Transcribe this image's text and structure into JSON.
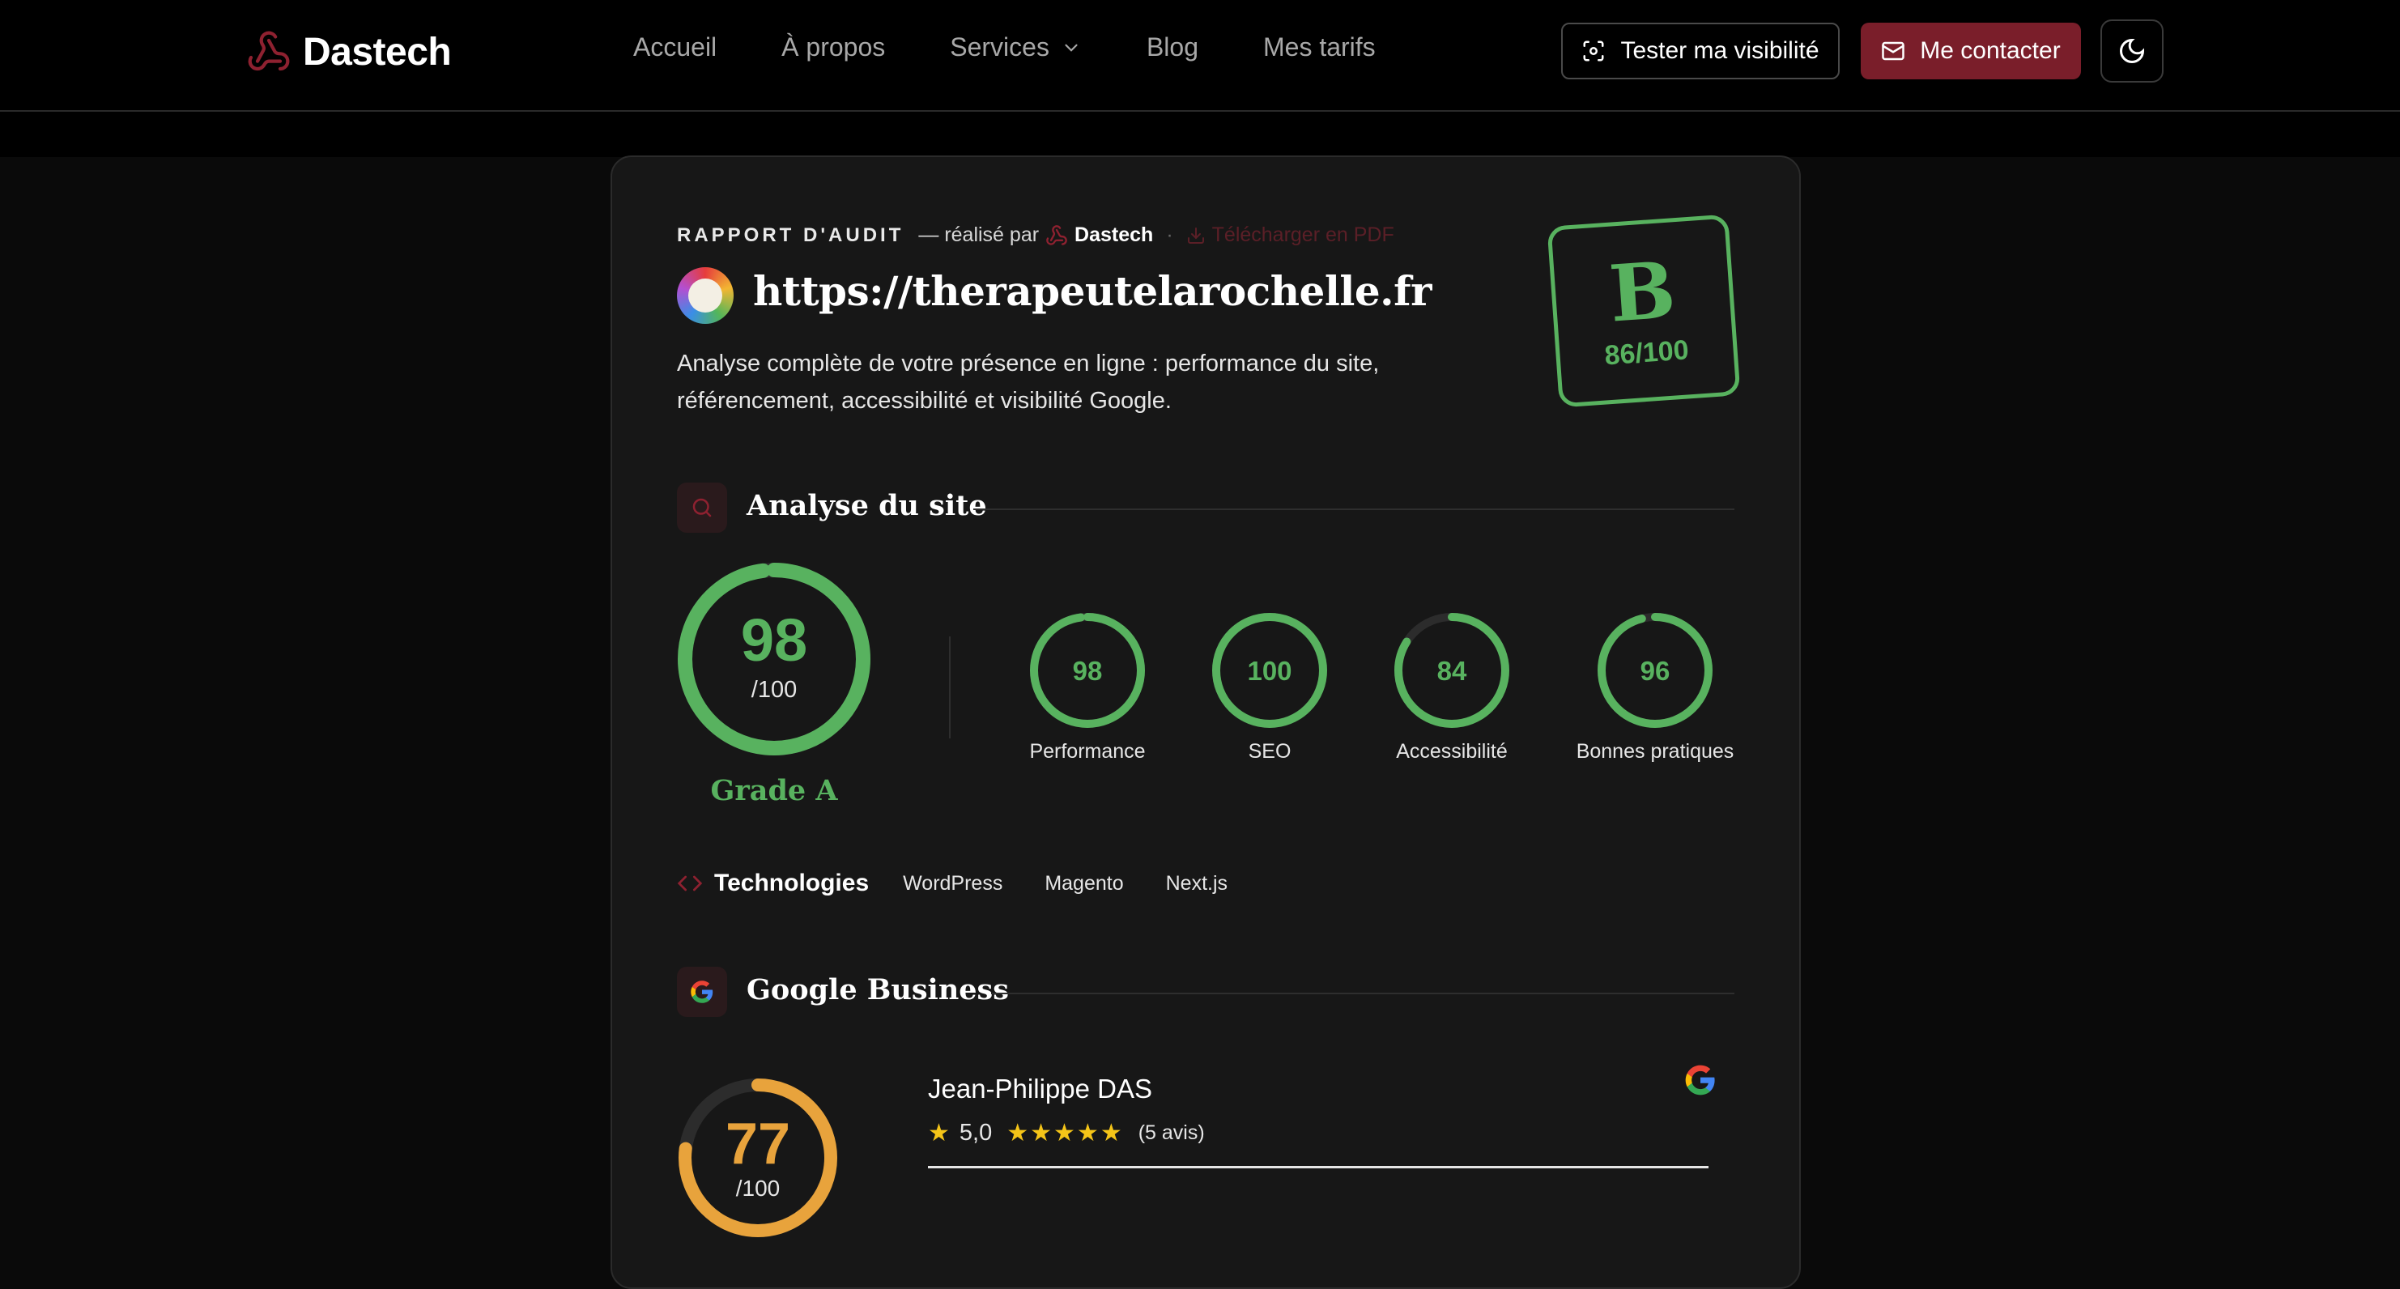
{
  "brand": {
    "name": "Dastech",
    "accent": "#7a1e2a",
    "success": "#58b25f",
    "warning": "#e8a33c"
  },
  "nav": {
    "items": [
      "Accueil",
      "À propos",
      "Services",
      "Blog",
      "Mes tarifs"
    ]
  },
  "header": {
    "test_label": "Tester ma visibilité",
    "contact_label": "Me contacter"
  },
  "report": {
    "label": "RAPPORT D'AUDIT",
    "by": "— réalisé par",
    "brand": "Dastech",
    "pdf": "Télécharger en PDF",
    "url": "https://therapeutelarochelle.fr",
    "description": "Analyse complète de votre présence en ligne : performance du site, référencement, accessibilité et visibilité Google.",
    "grade": "B",
    "score": "86/100"
  },
  "site_analysis": {
    "title": "Analyse du site",
    "overall": {
      "value": 98,
      "display": "98",
      "sub": "/100",
      "grade": "Grade A"
    },
    "metrics": [
      {
        "label": "Performance",
        "value": 98,
        "display": "98"
      },
      {
        "label": "SEO",
        "value": 100,
        "display": "100"
      },
      {
        "label": "Accessibilité",
        "value": 84,
        "display": "84"
      },
      {
        "label": "Bonnes pratiques",
        "value": 96,
        "display": "96"
      }
    ]
  },
  "technologies": {
    "title": "Technologies",
    "items": [
      "WordPress",
      "Magento",
      "Next.js"
    ]
  },
  "google_business": {
    "title": "Google Business",
    "score": {
      "value": 77,
      "display": "77",
      "sub": "/100"
    },
    "name": "Jean-Philippe DAS",
    "rating": "5,0",
    "stars": 5,
    "reviews": "(5 avis)"
  }
}
